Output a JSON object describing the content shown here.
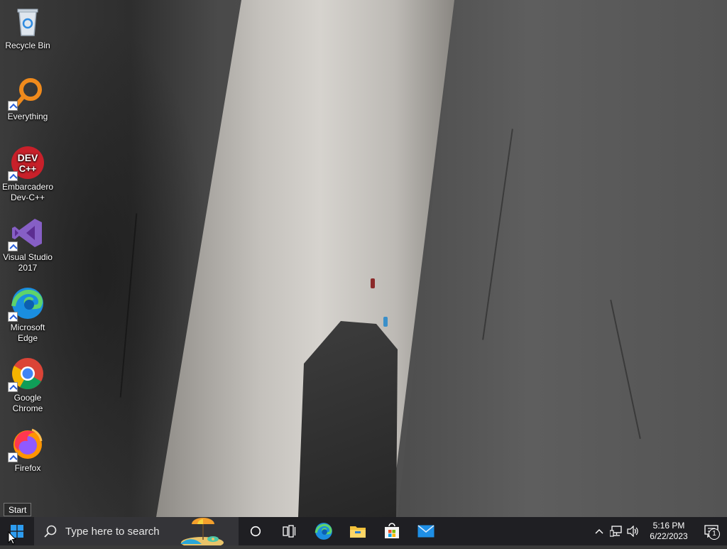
{
  "desktop": {
    "icons": [
      {
        "label": "Recycle Bin",
        "icon": "recycle-bin-icon"
      },
      {
        "label": "Everything",
        "icon": "everything-search-icon"
      },
      {
        "label": "Embarcadero Dev-C++",
        "line1": "Embarcadero",
        "line2": "Dev-C++",
        "icon": "devcpp-icon",
        "glyph_top": "DEV",
        "glyph_bottom": "C++"
      },
      {
        "label": "Visual Studio 2017",
        "line1": "Visual Studio",
        "line2": "2017",
        "icon": "visual-studio-icon"
      },
      {
        "label": "Microsoft Edge",
        "line1": "Microsoft",
        "line2": "Edge",
        "icon": "edge-icon"
      },
      {
        "label": "Google Chrome",
        "line1": "Google",
        "line2": "Chrome",
        "icon": "chrome-icon"
      },
      {
        "label": "Firefox",
        "icon": "firefox-icon"
      }
    ]
  },
  "tooltip": {
    "text": "Start"
  },
  "taskbar": {
    "search_placeholder": "Type here to search",
    "pinned": [
      "cortana-icon",
      "task-view-icon",
      "edge-icon",
      "file-explorer-icon",
      "microsoft-store-icon",
      "mail-icon"
    ],
    "tray": {
      "time": "5:16 PM",
      "date": "6/22/2023",
      "notification_count": "1",
      "icons": [
        "show-hidden-icons-chevron",
        "network-icon",
        "volume-icon"
      ]
    }
  },
  "colors": {
    "taskbar_bg": "#1f1f23",
    "search_bg": "#343438",
    "windows_blue": "#0078d7"
  }
}
